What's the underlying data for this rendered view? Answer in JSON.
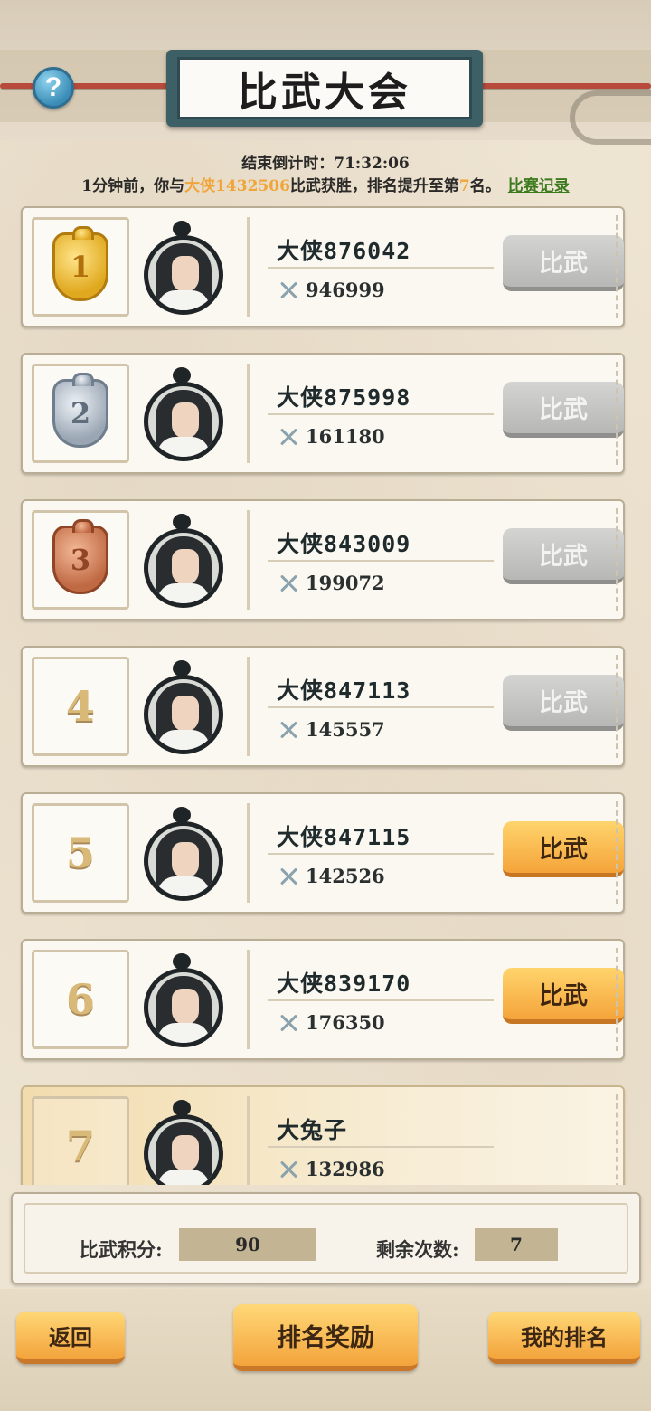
{
  "header": {
    "title": "比武大会",
    "help_icon": "question-icon",
    "countdown": "结束倒计时：71:32:06",
    "news_prefix": "1分钟前，你与",
    "news_name": "大侠1432506",
    "news_mid": "比武获胜，排名提升至第",
    "news_rank": "7",
    "news_suffix": "名。",
    "record_link": "比赛记录"
  },
  "players": [
    {
      "rank": "1",
      "name": "大侠876042",
      "power": "946999",
      "button": "比武",
      "button_state": "disabled",
      "medal": "gold"
    },
    {
      "rank": "2",
      "name": "大侠875998",
      "power": "161180",
      "button": "比武",
      "button_state": "disabled",
      "medal": "silver"
    },
    {
      "rank": "3",
      "name": "大侠843009",
      "power": "199072",
      "button": "比武",
      "button_state": "disabled",
      "medal": "bronze"
    },
    {
      "rank": "4",
      "name": "大侠847113",
      "power": "145557",
      "button": "比武",
      "button_state": "disabled",
      "medal": ""
    },
    {
      "rank": "5",
      "name": "大侠847115",
      "power": "142526",
      "button": "比武",
      "button_state": "active",
      "medal": ""
    },
    {
      "rank": "6",
      "name": "大侠839170",
      "power": "176350",
      "button": "比武",
      "button_state": "active",
      "medal": ""
    },
    {
      "rank": "7",
      "name": "大兔子",
      "power": "132986",
      "button": "",
      "button_state": "self",
      "medal": ""
    }
  ],
  "stats": {
    "points_label": "比武积分:",
    "points_value": "90",
    "remaining_label": "剩余次数:",
    "remaining_value": "7"
  },
  "footer": {
    "back": "返回",
    "rank_reward": "排名奖励",
    "my_rank": "我的排名"
  },
  "colors": {
    "accent_orange": "#f4a43a",
    "highlight_name": "#f0a53a",
    "link_green": "#3b7a1d",
    "disabled_gray": "#b7b7b5"
  }
}
